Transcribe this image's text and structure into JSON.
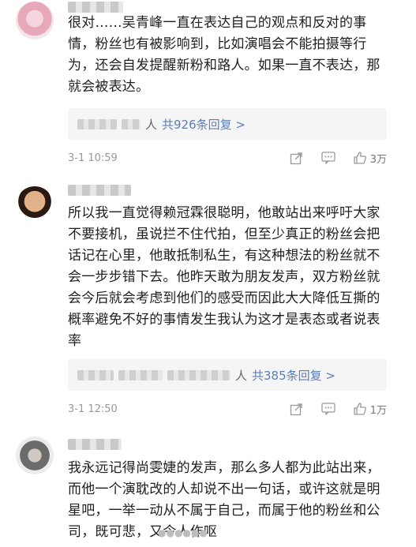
{
  "comments": [
    {
      "text": "很对……吴青峰一直在表达自己的观点和反对的事情，粉丝也有被影响到，比如演唱会不能拍摄等行为，还会自发提醒新粉和路人。如果一直不表达，那就会被表达。",
      "reply_suffix": "人",
      "reply_count": "共926条回复 >",
      "time": "3-1 10:59",
      "likes": "3万"
    },
    {
      "text": "所以我一直觉得赖冠霖很聪明，他敢站出来呼吁大家不要接机，虽说拦不住代拍，但至少真正的粉丝会把话记在心里，他敢抵制私生，有这种想法的粉丝就不会一步步错下去。他昨天敢为朋友发声，双方粉丝就会今后就会考虑到他们的感受而因此大大降低互撕的概率避免不好的事情发生我认为这才是表态或者说表率",
      "reply_suffix": "人",
      "reply_count": "共385条回复 >",
      "time": "3-1 12:50",
      "likes": "1万"
    },
    {
      "text": "我永远记得尚雯婕的发声，那么多人都为此站出来，而他一个演耽改的人却说不出一句话，或许这就是明星吧，一举一动从不属于自己，而属于他的粉丝和公司，既可悲，又令人作呕",
      "reply_suffix": "",
      "reply_count": "",
      "time": "",
      "likes": ""
    }
  ],
  "icons": [
    "share-icon",
    "comment-icon",
    "like-icon"
  ],
  "colors": {
    "link": "#5a7fb5",
    "meta": "#999999",
    "reply_bg": "#f5f5f5"
  }
}
